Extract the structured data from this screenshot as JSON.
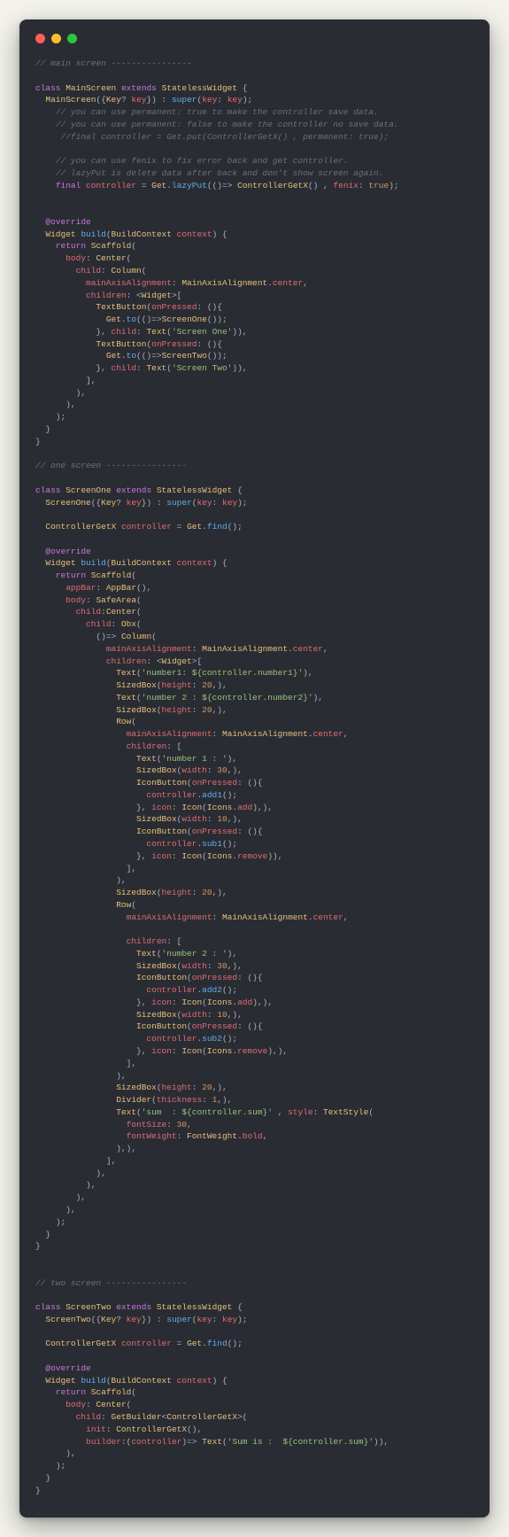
{
  "window": {
    "traffic_colors": {
      "close": "#ff5f57",
      "min": "#febc2e",
      "max": "#28c840"
    }
  },
  "code": {
    "c_main_header": "// main screen ----------------",
    "c_one_header": "// one screen ----------------",
    "c_two_header": "// two screen ----------------",
    "kw_class": "class",
    "kw_extends": "extends",
    "kw_return": "return",
    "kw_final": "final",
    "cls_MainScreen": "MainScreen",
    "cls_ScreenOne": "ScreenOne",
    "cls_ScreenTwo": "ScreenTwo",
    "cls_StatelessWidget": "StatelessWidget",
    "cls_Key": "Key",
    "cls_Widget": "Widget",
    "cls_BuildContext": "BuildContext",
    "cls_Scaffold": "Scaffold",
    "cls_Center": "Center",
    "cls_Column": "Column",
    "cls_Row": "Row",
    "cls_Text": "Text",
    "cls_TextButton": "TextButton",
    "cls_IconButton": "IconButton",
    "cls_Icon": "Icon",
    "cls_Icons": "Icons",
    "cls_SizedBox": "SizedBox",
    "cls_Divider": "Divider",
    "cls_AppBar": "AppBar",
    "cls_SafeArea": "SafeArea",
    "cls_Obx": "Obx",
    "cls_MainAxisAlignment": "MainAxisAlignment",
    "cls_ControllerGetX": "ControllerGetX",
    "cls_Get": "Get",
    "cls_TextStyle": "TextStyle",
    "cls_GetBuilder": "GetBuilder",
    "cls_FontWeight": "FontWeight",
    "fn_build": "build",
    "fn_super": "super",
    "fn_put": "put",
    "fn_lazyPut": "lazyPut",
    "fn_find": "find",
    "fn_to": "to",
    "fn_add1": "add1",
    "fn_sub1": "sub1",
    "fn_add2": "add2",
    "fn_sub2": "sub2",
    "ann_override": "@override",
    "var_key": "key",
    "var_controller": "controller",
    "var_context": "context",
    "prop_body": "body",
    "prop_appBar": "appBar",
    "prop_child": "child",
    "prop_children": "children",
    "prop_mainAxisAlignment": "mainAxisAlignment",
    "prop_onPressed": "onPressed",
    "prop_icon": "icon",
    "prop_center": "center",
    "prop_height": "height",
    "prop_width": "width",
    "prop_thickness": "thickness",
    "prop_style": "style",
    "prop_fontSize": "fontSize",
    "prop_fontWeight": "fontWeight",
    "prop_bold": "bold",
    "prop_permanent": "permanent",
    "prop_fenix": "fenix",
    "prop_init": "init",
    "prop_builder": "builder",
    "prop_add": "add",
    "prop_remove": "remove",
    "prop_number1": "number1",
    "prop_number2": "number2",
    "prop_sum": "sum",
    "str_ScreenOne": "'Screen One'",
    "str_ScreenTwo": "'Screen Two'",
    "str_number1_interp": "'number1: ${controller.number1}'",
    "str_number2_interp": "'number 2 : ${controller.number2}'",
    "str_number1_lbl": "'number 1 : '",
    "str_number2_lbl": "'number 2 : '",
    "str_sum_interp": "'sum  : ${controller.sum}'",
    "str_sum_is_interp": "'Sum is :  ${controller.sum}'",
    "num_20": "20",
    "num_30": "30",
    "num_10": "10",
    "num_1": "1",
    "num_fontSize30": "30",
    "bool_true": "true",
    "c_perm_true": "// you can use permanent: true to make the controller save data.",
    "c_perm_false": "// you can use permanent: false to make the controller no save data.",
    "c_final_put": "//final controller = Get.put(ControllerGetX() , permanent: true);",
    "c_fenix": "// you can use fenix to fix error back and get controller.",
    "c_lazyput": "// lazyPut is delete data after back and don't show screen again."
  }
}
